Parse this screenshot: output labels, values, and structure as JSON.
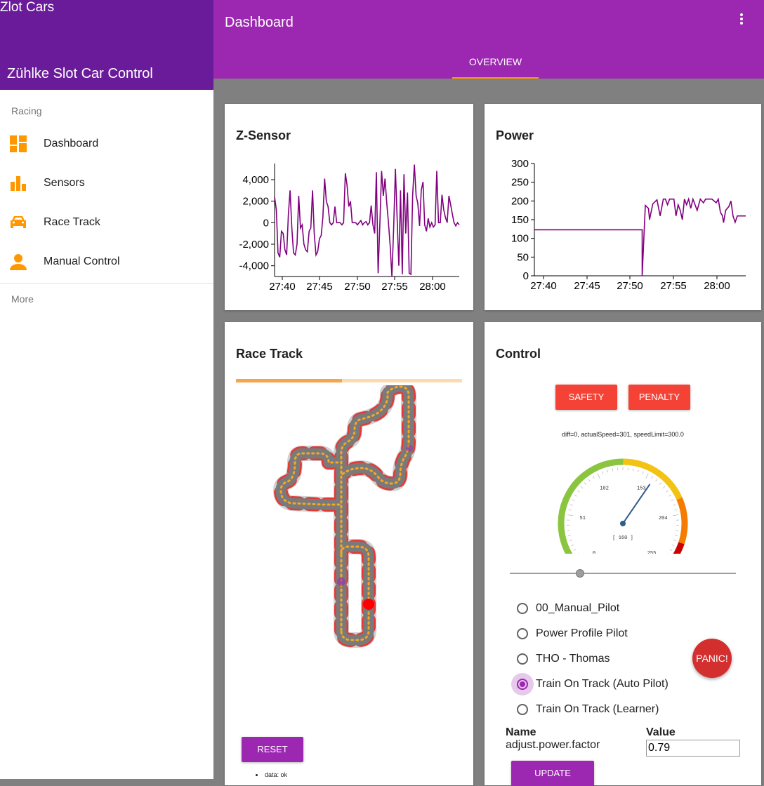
{
  "sidebar": {
    "app_name": "Zlot Cars",
    "subtitle": "Zühlke Slot Car Control",
    "section_racing": "Racing",
    "items": [
      {
        "label": "Dashboard",
        "icon": "dashboard-icon"
      },
      {
        "label": "Sensors",
        "icon": "bar-chart-icon"
      },
      {
        "label": "Race Track",
        "icon": "car-icon"
      },
      {
        "label": "Manual Control",
        "icon": "person-icon"
      }
    ],
    "section_more": "More",
    "accent": "#ff9800"
  },
  "appbar": {
    "title": "Dashboard",
    "tab": "OVERVIEW",
    "color": "#9c27b0"
  },
  "zsensor": {
    "title": "Z-Sensor",
    "chart_data": {
      "type": "line",
      "x_ticks": [
        "27:40",
        "27:45",
        "27:50",
        "27:55",
        "28:00"
      ],
      "y_ticks": [
        "4,000",
        "2,000",
        "0",
        "-2,000",
        "-4,000"
      ],
      "ylim": [
        -5000,
        5500
      ],
      "color": "#800080",
      "series": [
        {
          "values": [
            2400,
            1200,
            -2800,
            -3200,
            -800,
            -1000,
            -2500,
            -3000,
            800,
            3000,
            -500,
            -2800,
            -3000,
            -2000,
            2500,
            -500,
            -200,
            -2000,
            -2500,
            -2700,
            -800,
            -500,
            3000,
            -1000,
            -3000,
            -2700,
            -1500,
            -1200,
            500,
            4100,
            2000,
            1500,
            0,
            -200,
            0,
            1500,
            0,
            0,
            0,
            -200,
            0,
            4600,
            3500,
            1500,
            2000,
            0,
            0,
            0,
            -200,
            0,
            200,
            -200,
            0,
            100,
            -200,
            0,
            1600,
            -200,
            -1000,
            4700,
            -4700,
            -200,
            4800,
            2500,
            4100,
            1800,
            0,
            -2200,
            -5000,
            -500,
            5000,
            500,
            -4000,
            3000,
            -4800,
            4500,
            -1000,
            2800,
            -4700,
            -4800,
            2500,
            5400,
            2500,
            1800,
            -300,
            3000,
            3800,
            -200,
            -800,
            400,
            -400,
            0,
            -400,
            -200,
            4800,
            0,
            0,
            2600,
            1200,
            500,
            0,
            2500,
            1700,
            800,
            0,
            -300,
            0,
            -200
          ]
        }
      ]
    }
  },
  "power": {
    "title": "Power",
    "chart_data": {
      "type": "line",
      "x_ticks": [
        "27:40",
        "27:45",
        "27:50",
        "27:55",
        "28:00"
      ],
      "y_ticks": [
        "300",
        "250",
        "200",
        "150",
        "100",
        "50",
        "0"
      ],
      "ylim": [
        0,
        300
      ],
      "color": "#800080",
      "series": [
        {
          "points": [
            [
              0,
              123
            ],
            [
              0.51,
              123
            ],
            [
              0.51,
              0
            ],
            [
              0.525,
              188
            ],
            [
              0.54,
              180
            ],
            [
              0.545,
              150
            ],
            [
              0.56,
              192
            ],
            [
              0.58,
              203
            ],
            [
              0.595,
              160
            ],
            [
              0.61,
              205
            ],
            [
              0.62,
              205
            ],
            [
              0.63,
              190
            ],
            [
              0.64,
              205
            ],
            [
              0.66,
              205
            ],
            [
              0.67,
              160
            ],
            [
              0.68,
              190
            ],
            [
              0.69,
              175
            ],
            [
              0.7,
              150
            ],
            [
              0.71,
              205
            ],
            [
              0.72,
              190
            ],
            [
              0.73,
              205
            ],
            [
              0.74,
              180
            ],
            [
              0.75,
              205
            ],
            [
              0.77,
              175
            ],
            [
              0.785,
              205
            ],
            [
              0.8,
              195
            ],
            [
              0.81,
              205
            ],
            [
              0.83,
              205
            ],
            [
              0.84,
              205
            ],
            [
              0.86,
              195
            ],
            [
              0.87,
              205
            ],
            [
              0.88,
              170
            ],
            [
              0.89,
              160
            ],
            [
              0.895,
              142
            ],
            [
              0.905,
              175
            ],
            [
              0.92,
              185
            ],
            [
              0.93,
              200
            ],
            [
              0.94,
              160
            ],
            [
              0.95,
              143
            ],
            [
              0.96,
              160
            ],
            [
              1.0,
              160
            ]
          ]
        }
      ]
    }
  },
  "racetrack": {
    "title": "Race Track",
    "progress": 0.47,
    "reset_label": "RESET",
    "status": "data: ok"
  },
  "control": {
    "title": "Control",
    "safety_label": "SAFETY",
    "penalty_label": "PENALTY",
    "status_text": "diff=0, actualSpeed=301, speedLimit=300.0",
    "gauge": {
      "tick_labels": [
        "0",
        "51",
        "102",
        "153",
        "204",
        "255"
      ],
      "value": 160,
      "readout": "[ 160 ]",
      "max": 255
    },
    "slider_value": 0.31,
    "pilots": [
      {
        "label": "00_Manual_Pilot",
        "selected": false
      },
      {
        "label": "Power Profile Pilot",
        "selected": false
      },
      {
        "label": "THO - Thomas",
        "selected": false
      },
      {
        "label": "Train On Track (Auto Pilot)",
        "selected": true
      },
      {
        "label": "Train On Track (Learner)",
        "selected": false
      }
    ],
    "panic_label": "PANIC!",
    "param_name_header": "Name",
    "param_value_header": "Value",
    "param_name": "adjust.power.factor",
    "param_value": "0.79",
    "update_label": "UPDATE"
  }
}
